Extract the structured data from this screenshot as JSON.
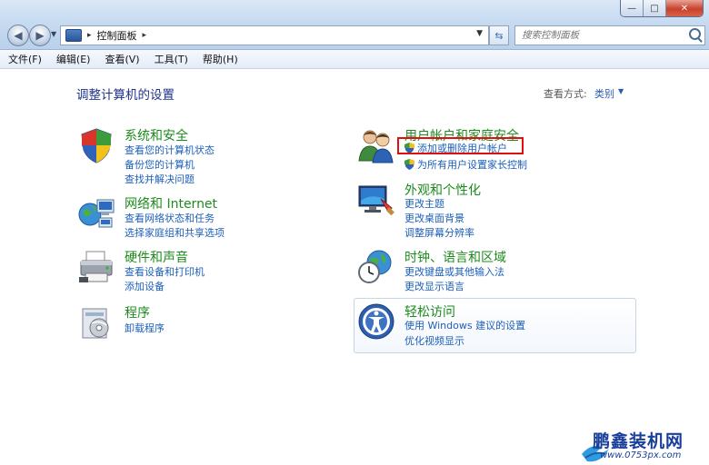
{
  "window": {
    "minimize_glyph": "—",
    "maximize_glyph": "□",
    "close_glyph": "✕"
  },
  "address_bar": {
    "crumb": "控制面板",
    "separator": "▸"
  },
  "search": {
    "placeholder": "搜索控制面板"
  },
  "menu": [
    "文件(F)",
    "编辑(E)",
    "查看(V)",
    "工具(T)",
    "帮助(H)"
  ],
  "page": {
    "title": "调整计算机的设置",
    "view_by_label": "查看方式:",
    "view_by_value": "类别"
  },
  "categories": {
    "system": {
      "title": "系统和安全",
      "links": [
        "查看您的计算机状态",
        "备份您的计算机",
        "查找并解决问题"
      ]
    },
    "network": {
      "title": "网络和 Internet",
      "links": [
        "查看网络状态和任务",
        "选择家庭组和共享选项"
      ]
    },
    "hardware": {
      "title": "硬件和声音",
      "links": [
        "查看设备和打印机",
        "添加设备"
      ]
    },
    "programs": {
      "title": "程序",
      "links": [
        "卸载程序"
      ]
    },
    "accounts": {
      "title": "用户帐户和家庭安全",
      "links": [
        "添加或删除用户帐户",
        "为所有用户设置家长控制"
      ]
    },
    "appearance": {
      "title": "外观和个性化",
      "links": [
        "更改主题",
        "更改桌面背景",
        "调整屏幕分辨率"
      ]
    },
    "clock": {
      "title": "时钟、语言和区域",
      "links": [
        "更改键盘或其他输入法",
        "更改显示语言"
      ]
    },
    "ease": {
      "title": "轻松访问",
      "links": [
        "使用 Windows 建议的设置",
        "优化视频显示"
      ]
    }
  },
  "watermark": {
    "brand": "鹏鑫装机网",
    "url": "www.0753px.com"
  },
  "colors": {
    "category_title": "#1d8a1d",
    "link": "#1d5fb8",
    "highlight": "#e01010"
  }
}
